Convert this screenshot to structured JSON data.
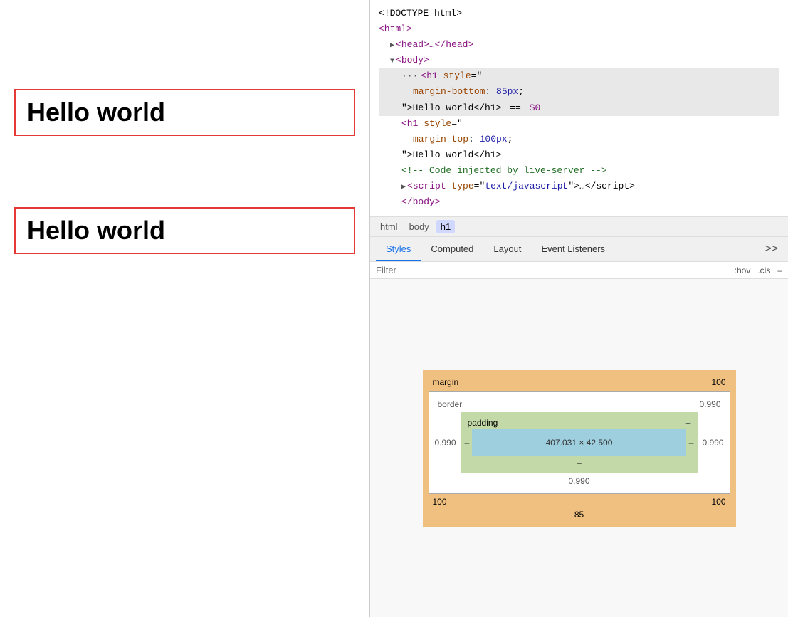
{
  "left_panel": {
    "hello_world_1": "Hello world",
    "hello_world_2": "Hello world"
  },
  "devtools": {
    "dom": {
      "lines": [
        {
          "indent": 0,
          "content": "doctype",
          "text": "<!DOCTYPE html>"
        },
        {
          "indent": 0,
          "content": "html_open",
          "text": "<html>"
        },
        {
          "indent": 1,
          "content": "head",
          "text": "<head>…</head>",
          "collapsed": true
        },
        {
          "indent": 1,
          "content": "body_open",
          "text": "<body>",
          "expanded": true
        },
        {
          "indent": 2,
          "content": "h1_open",
          "text": "<h1 style=\"\"",
          "highlighted": true
        },
        {
          "indent": 3,
          "content": "margin_bottom",
          "text": "margin-bottom: 85px;"
        },
        {
          "indent": 2,
          "content": "h1_content",
          "text": "\">Hello world</h1> == $0"
        },
        {
          "indent": 2,
          "content": "h1_2_open",
          "text": "<h1 style=\"\""
        },
        {
          "indent": 3,
          "content": "margin_top",
          "text": "margin-top: 100px;"
        },
        {
          "indent": 2,
          "content": "h1_2_content",
          "text": "\">Hello world</h1>"
        },
        {
          "indent": 2,
          "content": "comment",
          "text": "<!-- Code injected by live-server -->"
        },
        {
          "indent": 2,
          "content": "script",
          "text": "<script type=\"text/javascript\">…</script>"
        },
        {
          "indent": 2,
          "content": "body_close",
          "text": "</body>"
        }
      ]
    },
    "breadcrumb": {
      "items": [
        "html",
        "body",
        "h1"
      ],
      "active_index": 2
    },
    "tabs": {
      "items": [
        "Styles",
        "Computed",
        "Layout",
        "Event Listeners"
      ],
      "active_index": 0,
      "more_label": ">>"
    },
    "filter": {
      "placeholder": "Filter",
      "hover_cls": ":hov",
      "dot_cls": ".cls",
      "dash": "–"
    },
    "box_model": {
      "margin_top": "100",
      "margin_bottom": "85",
      "margin_left": "100",
      "margin_right": "100",
      "border_top": "0.990",
      "border_bottom": "0.990",
      "border_left": "0.990",
      "border_right": "0.990",
      "padding_top": "–",
      "padding_bottom": "–",
      "padding_left": "–",
      "padding_right": "–",
      "content_size": "407.031 × 42.500",
      "margin_label": "margin",
      "border_label": "border",
      "padding_label": "padding"
    }
  }
}
